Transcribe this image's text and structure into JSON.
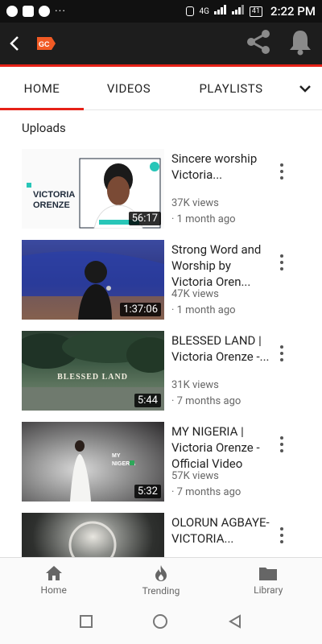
{
  "status_bar": {
    "time": "2:22 PM",
    "battery": "41",
    "network": "4G"
  },
  "app_bar": {
    "logo": "GC"
  },
  "tabs": [
    {
      "label": "HOME"
    },
    {
      "label": "VIDEOS"
    },
    {
      "label": "PLAYLISTS"
    }
  ],
  "section_title": "Uploads",
  "videos": [
    {
      "title": "Sincere worship Victoria...",
      "views": "37K views",
      "age": "· 1 month ago",
      "duration": "56:17",
      "thumb_text_1": "VICTORIA",
      "thumb_text_2": "ORENZE"
    },
    {
      "title": "Strong Word and Worship by Victoria Oren...",
      "views": "47K views",
      "age": "· 1 month ago",
      "duration": "1:37:06"
    },
    {
      "title": "BLESSED LAND | Victoria Orenze -...",
      "views": "31K views",
      "age": "· 7 months ago",
      "duration": "5:44",
      "thumb_text_1": "BLESSED LAND"
    },
    {
      "title": "MY NIGERIA | Victoria Orenze - Official Video",
      "views": "57K views",
      "age": "· 7 months ago",
      "duration": "5:32",
      "thumb_text_1": "MY",
      "thumb_text_2": "NIGERIA"
    },
    {
      "title": "OLORUN AGBAYE-VICTORIA...",
      "views": "",
      "age": "",
      "duration": ""
    }
  ],
  "bottom_nav": [
    {
      "label": "Home",
      "icon": "home-icon"
    },
    {
      "label": "Trending",
      "icon": "flame-icon"
    },
    {
      "label": "Library",
      "icon": "folder-icon"
    }
  ],
  "colors": {
    "accent": "#e62117",
    "app_bar": "#1d1d1d"
  }
}
